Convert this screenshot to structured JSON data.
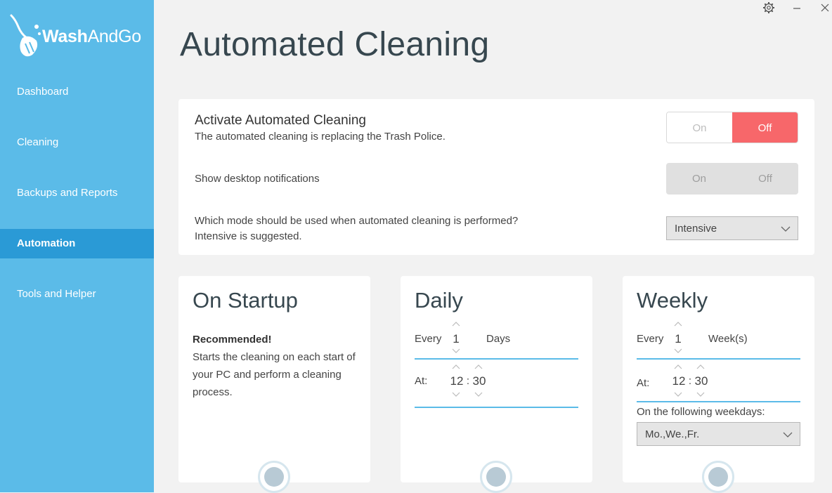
{
  "app": {
    "name_bold": "Wash",
    "name_rest": "AndGo"
  },
  "window": {
    "settings_icon": "gear-icon",
    "minimize_icon": "minimize-icon",
    "close_icon": "close-icon"
  },
  "sidebar": {
    "items": [
      {
        "label": "Dashboard",
        "active": false
      },
      {
        "label": "Cleaning",
        "active": false
      },
      {
        "label": "Backups and Reports",
        "active": false
      },
      {
        "label": "Automation",
        "active": true
      },
      {
        "label": "Tools and Helper",
        "active": false
      }
    ]
  },
  "page": {
    "title": "Automated Cleaning"
  },
  "settings": {
    "activate": {
      "title": "Activate Automated Cleaning",
      "description": "The automated cleaning is replacing the Trash Police.",
      "on_label": "On",
      "off_label": "Off",
      "selected": "Off"
    },
    "notifications": {
      "label": "Show desktop notifications",
      "on_label": "On",
      "off_label": "Off",
      "disabled": true
    },
    "mode": {
      "question": "Which mode should be used when automated cleaning is performed?",
      "hint": "Intensive is suggested.",
      "selected": "Intensive"
    }
  },
  "cards": {
    "startup": {
      "title": "On Startup",
      "recommended": "Recommended!",
      "description": "Starts the cleaning on each start of your PC and perform a cleaning process."
    },
    "daily": {
      "title": "Daily",
      "every_label": "Every",
      "every_value": "1",
      "unit": "Days",
      "at_label": "At:",
      "hour": "12",
      "sep": ":",
      "minute": "30"
    },
    "weekly": {
      "title": "Weekly",
      "every_label": "Every",
      "every_value": "1",
      "unit": "Week(s)",
      "at_label": "At:",
      "hour": "12",
      "sep": ":",
      "minute": "30",
      "weekdays_label": "On the following weekdays:",
      "weekdays_value": "Mo.,We.,Fr."
    }
  },
  "colors": {
    "sidebar": "#5bbbe8",
    "active_nav": "#2a9ad6",
    "off_red": "#f7676a",
    "accent": "#5bbbe8"
  }
}
